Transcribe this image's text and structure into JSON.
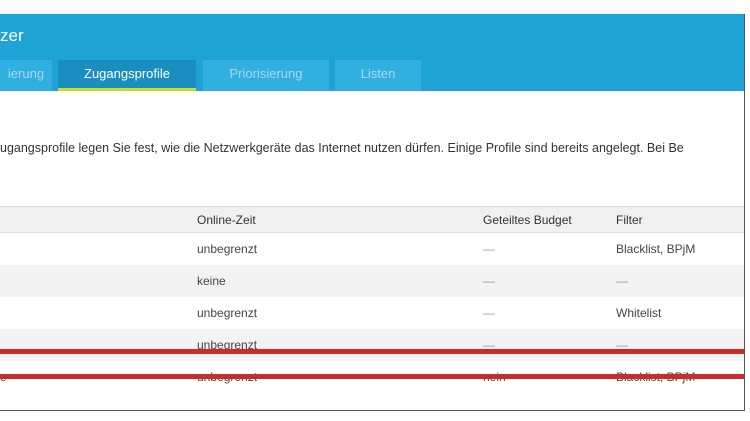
{
  "app": {
    "title_fragment": "zer"
  },
  "tabs": [
    {
      "label": "ierung",
      "active": false
    },
    {
      "label": "Zugangsprofile",
      "active": true
    },
    {
      "label": "Priorisierung",
      "active": false
    },
    {
      "label": "Listen",
      "active": false
    }
  ],
  "page": {
    "heading_fragment": "",
    "description": "ugangsprofile legen Sie fest, wie die Netzwerkgeräte das Internet nutzen dürfen. Einige Profile sind bereits angelegt. Bei Be"
  },
  "table": {
    "headers": {
      "name": "",
      "online_time": "Online-Zeit",
      "shared_budget": "Geteiltes Budget",
      "filter": "Filter"
    },
    "rows": [
      {
        "name": "",
        "online_time": "unbegrenzt",
        "shared_budget": "—",
        "filter": "Blacklist, BPjM"
      },
      {
        "name": "",
        "online_time": "keine",
        "shared_budget": "—",
        "filter": "—"
      },
      {
        "name": "",
        "online_time": "unbegrenzt",
        "shared_budget": "—",
        "filter": "Whitelist"
      },
      {
        "name": "",
        "online_time": "unbegrenzt",
        "shared_budget": "—",
        "filter": "—"
      },
      {
        "name": "e",
        "online_time": "unbegrenzt",
        "shared_budget": "nein",
        "filter": "Blacklist, BPjM",
        "highlighted": true
      }
    ]
  },
  "colors": {
    "header_bg": "#1fa2d6",
    "active_tab_bg": "#1a8ec0",
    "active_tab_underline": "#c8dc2a",
    "highlight": "#cc2b2b"
  }
}
